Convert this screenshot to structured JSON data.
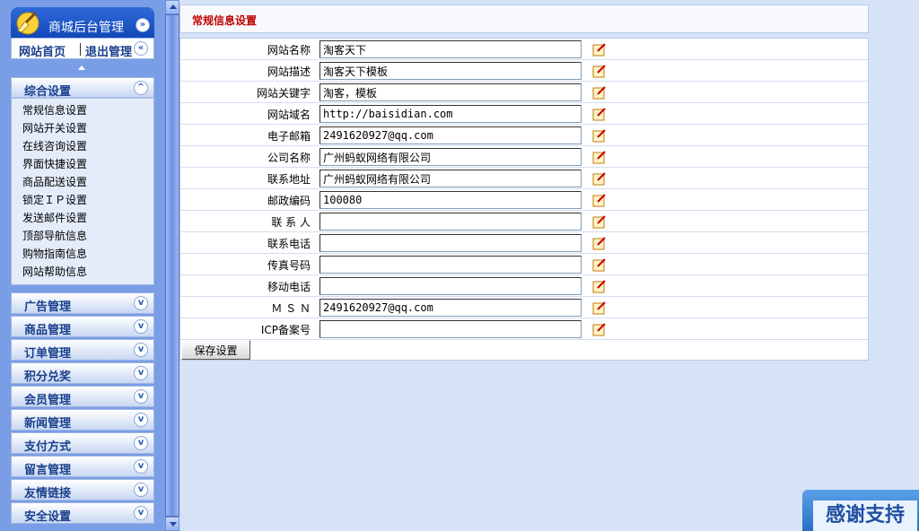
{
  "sidebar": {
    "title": "商城后台管理",
    "links": {
      "home": "网站首页",
      "logout": "退出管理"
    },
    "active_section": {
      "label": "综合设置",
      "items": [
        "常规信息设置",
        "网站开关设置",
        "在线咨询设置",
        "界面快捷设置",
        "商品配送设置",
        "锁定ＩＰ设置",
        "发送邮件设置",
        "顶部导航信息",
        "购物指南信息",
        "网站帮助信息"
      ]
    },
    "groups": [
      "广告管理",
      "商品管理",
      "订单管理",
      "积分兑奖",
      "会员管理",
      "新闻管理",
      "支付方式",
      "留言管理",
      "友情链接",
      "安全设置"
    ]
  },
  "main": {
    "title": "常规信息设置",
    "fields": [
      {
        "label": "网站名称",
        "value": "淘客天下"
      },
      {
        "label": "网站描述",
        "value": "淘客天下模板"
      },
      {
        "label": "网站关键字",
        "value": "淘客，模板"
      },
      {
        "label": "网站域名",
        "value": "http://baisidian.com"
      },
      {
        "label": "电子邮箱",
        "value": "2491620927@qq.com"
      },
      {
        "label": "公司名称",
        "value": "广州蚂蚁网络有限公司"
      },
      {
        "label": "联系地址",
        "value": "广州蚂蚁网络有限公司"
      },
      {
        "label": "邮政编码",
        "value": "100080"
      },
      {
        "label": "联 系 人",
        "value": ""
      },
      {
        "label": "联系电话",
        "value": ""
      },
      {
        "label": "传真号码",
        "value": ""
      },
      {
        "label": "移动电话",
        "value": ""
      },
      {
        "label": "Ｍ Ｓ Ｎ",
        "value": "2491620927@qq.com"
      },
      {
        "label": "ICP备案号",
        "value": ""
      }
    ],
    "save_label": "保存设置"
  },
  "badge": {
    "text": "感谢支持"
  },
  "colors": {
    "accent": "#1a3f8c",
    "title_red": "#c00000",
    "sidebar_bg": "#7a9ee6"
  }
}
